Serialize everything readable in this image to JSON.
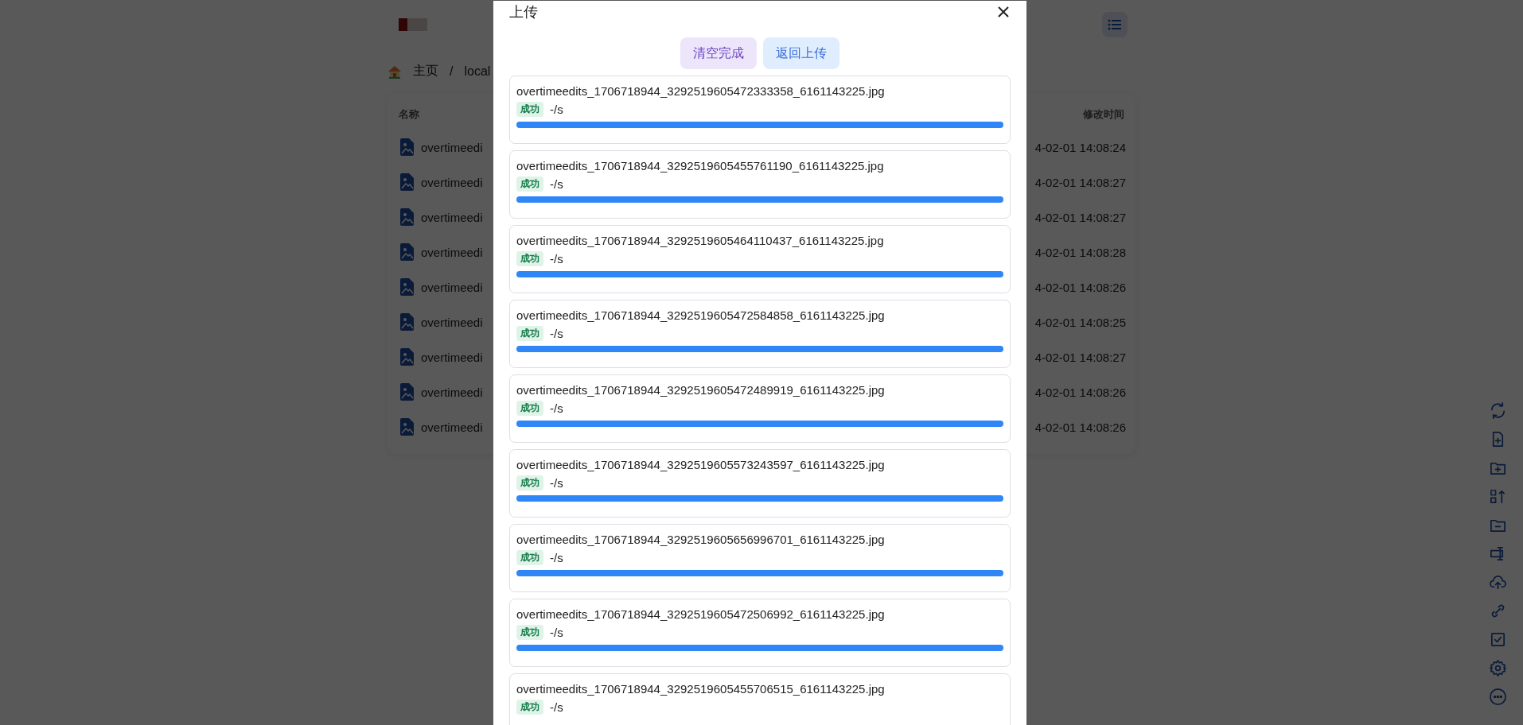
{
  "breadcrumb": {
    "separator": "/",
    "items": [
      {
        "label": "主页",
        "kind": "home"
      },
      {
        "label": "local",
        "kind": "folder"
      }
    ]
  },
  "file_table": {
    "columns": [
      "名称",
      "修改时间"
    ],
    "rows": [
      {
        "name": "overtimeedi",
        "modified": "4-02-01 14:08:24"
      },
      {
        "name": "overtimeedi",
        "modified": "4-02-01 14:08:27"
      },
      {
        "name": "overtimeedi",
        "modified": "4-02-01 14:08:27"
      },
      {
        "name": "overtimeedi",
        "modified": "4-02-01 14:08:28"
      },
      {
        "name": "overtimeedi",
        "modified": "4-02-01 14:08:26"
      },
      {
        "name": "overtimeedi",
        "modified": "4-02-01 14:08:25"
      },
      {
        "name": "overtimeedi",
        "modified": "4-02-01 14:08:27"
      },
      {
        "name": "overtimeedi",
        "modified": "4-02-01 14:08:26"
      },
      {
        "name": "overtimeedi",
        "modified": "4-02-01 14:08:26"
      }
    ]
  },
  "upload_dialog": {
    "title": "上传",
    "buttons": [
      {
        "label": "清空完成",
        "kind": "clear"
      },
      {
        "label": "返回上传",
        "kind": "back"
      }
    ],
    "items": [
      {
        "name": "overtimeedits_1706718944_3292519605472333358_6161143225.jpg",
        "status": "成功",
        "speed": "-/s",
        "level": 1
      },
      {
        "name": "overtimeedits_1706718944_3292519605455761190_6161143225.jpg",
        "status": "成功",
        "speed": "-/s",
        "level": 1
      },
      {
        "name": "overtimeedits_1706718944_3292519605464110437_6161143225.jpg",
        "status": "成功",
        "speed": "-/s",
        "level": 1
      },
      {
        "name": "overtimeedits_1706718944_3292519605472584858_6161143225.jpg",
        "status": "成功",
        "speed": "-/s",
        "level": 1
      },
      {
        "name": "overtimeedits_1706718944_3292519605472489919_6161143225.jpg",
        "status": "成功",
        "speed": "-/s",
        "level": 1
      },
      {
        "name": "overtimeedits_1706718944_3292519605573243597_6161143225.jpg",
        "status": "成功",
        "speed": "-/s",
        "level": 1
      },
      {
        "name": "overtimeedits_1706718944_3292519605656996701_6161143225.jpg",
        "status": "成功",
        "speed": "-/s",
        "level": 1
      },
      {
        "name": "overtimeedits_1706718944_3292519605472506992_6161143225.jpg",
        "status": "成功",
        "speed": "-/s",
        "level": 1
      },
      {
        "name": "overtimeedits_1706718944_3292519605455706515_6161143225.jpg",
        "status": "成功",
        "speed": "-/s"
      }
    ]
  }
}
